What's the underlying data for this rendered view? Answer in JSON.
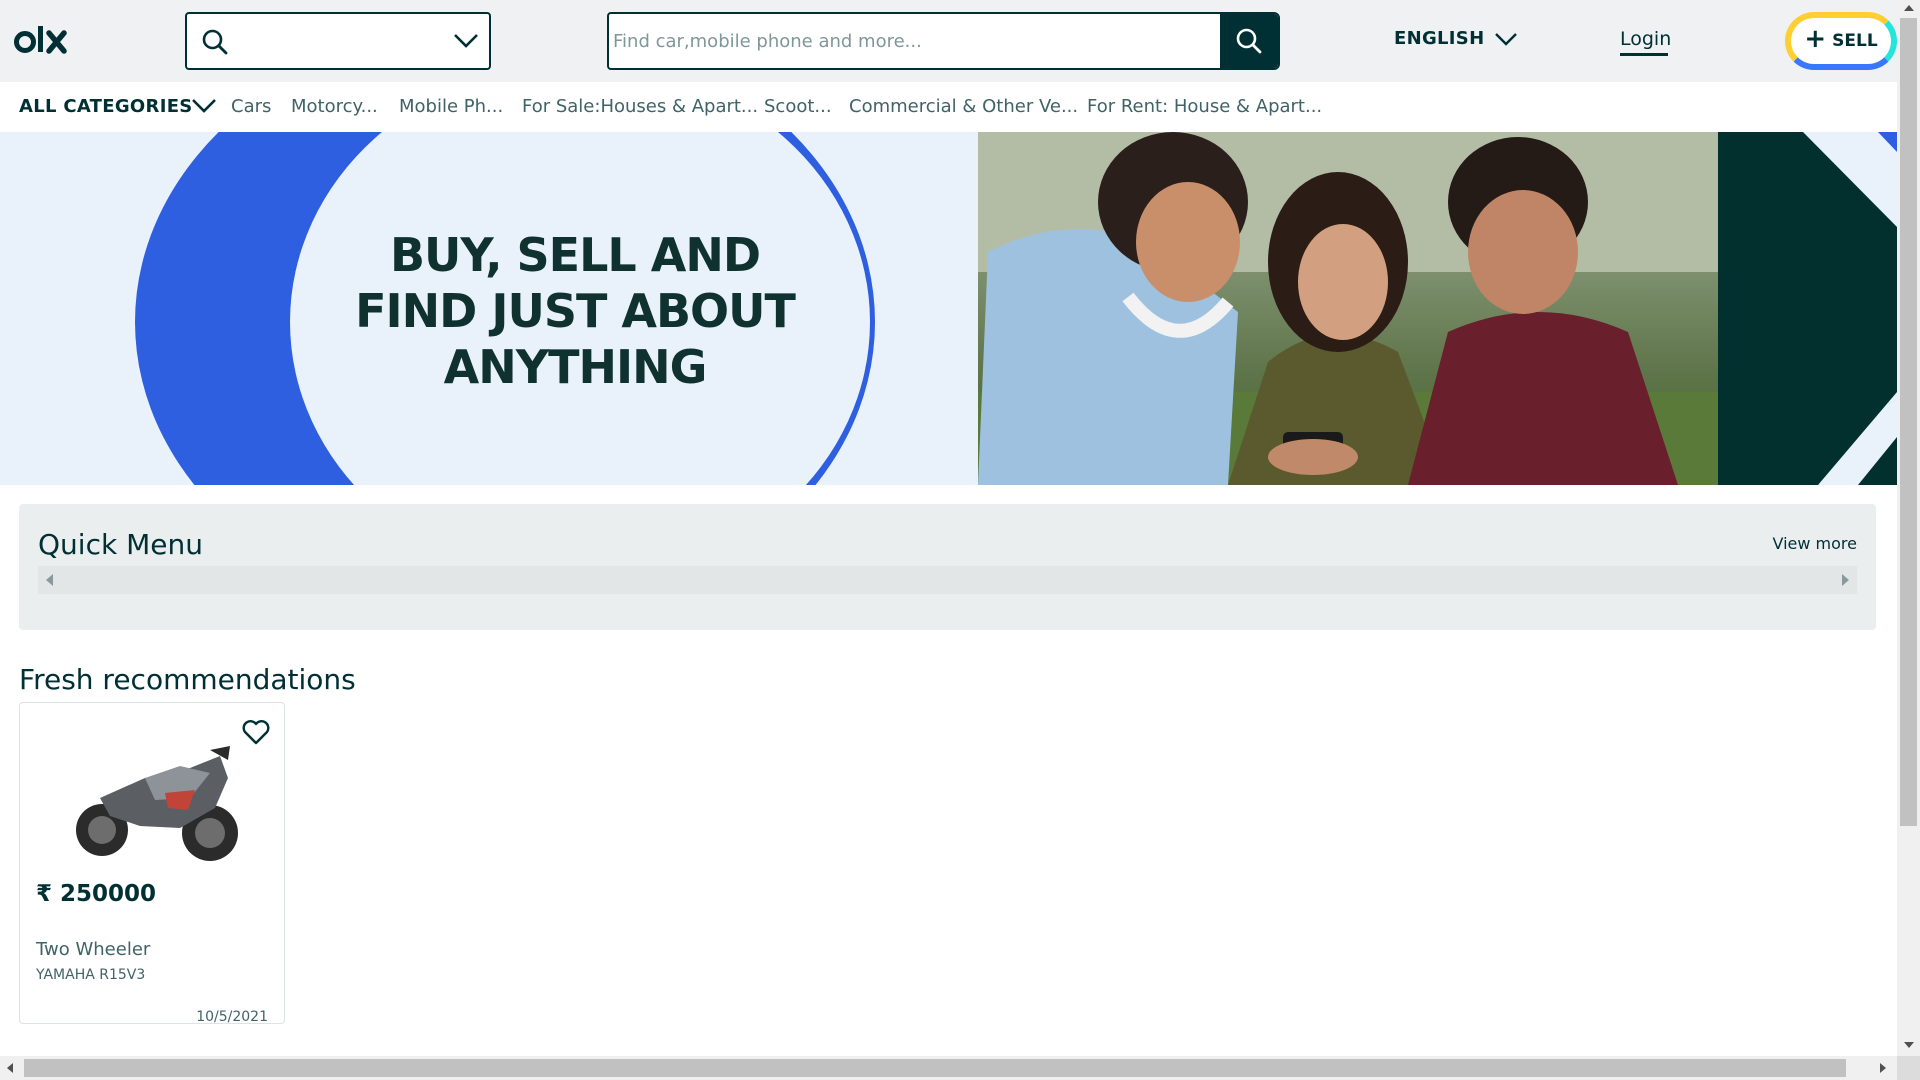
{
  "header": {
    "logo_text": "olx",
    "location_icon": "search-icon",
    "location_chevron": "chevron-down-icon",
    "search_placeholder": "Find car,mobile phone and more...",
    "search_button_icon": "search-icon",
    "language": "ENGLISH",
    "login": "Login",
    "sell": "SELL",
    "sell_plus": "+"
  },
  "categories": {
    "all": "ALL CATEGORIES",
    "items": [
      "Cars",
      "Motorcy...",
      "Mobile Ph...",
      "For Sale:Houses & Apart...",
      "Scoot...",
      "Commercial & Other Ve...",
      "For Rent: House & Apart..."
    ]
  },
  "banner": {
    "line1": "BUY, SELL AND",
    "line2": "FIND JUST ABOUT",
    "line3": "ANYTHING"
  },
  "quick_menu": {
    "title": "Quick Menu",
    "view_more": "View more"
  },
  "fresh": {
    "title": "Fresh recommendations",
    "cards": [
      {
        "price": "₹ 250000",
        "title": "Two Wheeler",
        "subtitle": "YAMAHA R15V3",
        "date": "10/5/2021",
        "image_icon": "motorcycle-image",
        "favorite_icon": "heart-icon"
      }
    ]
  },
  "colors": {
    "brand_dark": "#002f34",
    "banner_blue": "#2d5fe0",
    "banner_light": "#e9f1fb",
    "banner_teal": "#02302f",
    "sell_yellow": "#ffce32",
    "sell_blue": "#3a77ff",
    "sell_cyan": "#23e5db"
  }
}
